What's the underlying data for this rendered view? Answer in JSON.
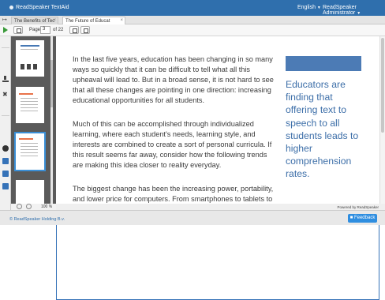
{
  "app": {
    "title": "ReadSpeaker TextAid"
  },
  "header": {
    "language": "English",
    "user": "ReadSpeaker Administrator"
  },
  "tabs": [
    {
      "label": "The Benefits of Tec"
    },
    {
      "label": "The Future of Educat"
    }
  ],
  "toolbar": {
    "page_label": "Page",
    "page_value": "3",
    "page_of": "of 22"
  },
  "sidebar_icons": [
    "collapse-icon",
    "document-icon",
    "file-icon",
    "download-icon",
    "tools-icon",
    "layout-icon",
    "globe-icon",
    "accessibility-icon",
    "text-size-icon",
    "settings-icon"
  ],
  "thumbnails": [
    {
      "title": "THE FUTURE OF EDUCATION"
    },
    {
      "title": "CONTENTS"
    },
    {
      "title": "INTRODUCTION"
    }
  ],
  "zoom": {
    "value": "100 %"
  },
  "document": {
    "paragraphs": [
      "In the last five years, education has been changing in so many ways so quickly that it can be difficult to tell what all this upheaval will lead to. But in a broad sense, it is not hard to see that all these changes are pointing in one direction: increasing educational opportunities for all students.",
      "Much of this can be accomplished through individualized learning, where each student's needs, learning style, and interests are combined to create a sort of personal curricula. If this result seems far away, consider how the following trends are making this idea closer to reality everyday.",
      "The biggest change has been the increasing power, portability, and lower price for computers. From smartphones to tablets to"
    ],
    "pull_quote": "Educators are finding that offering text to speech to all students leads to higher comprehension rates."
  },
  "powered_by": "Powered by ReadSpeaker",
  "footer": {
    "copyright": "© ReadSpeaker Holding B.v.",
    "feedback": "Feedback"
  },
  "colors": {
    "topbar": "#2f6fad",
    "accent": "#4c7bb5",
    "thumb_selected": "#3b8fd6",
    "feedback": "#2f8ee0"
  }
}
